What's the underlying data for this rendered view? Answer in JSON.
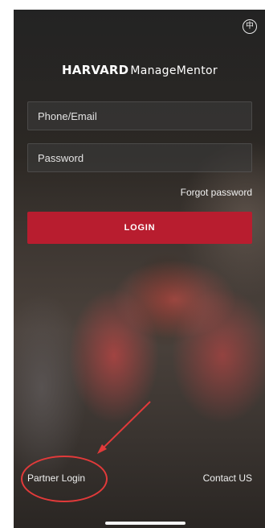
{
  "header": {
    "language_icon": "globe-icon",
    "language_glyph": "中",
    "logo_brand": "HARVARD",
    "logo_product": "ManageMentor"
  },
  "form": {
    "phone_email_placeholder": "Phone/Email",
    "password_placeholder": "Password",
    "forgot_password_label": "Forgot password",
    "login_label": "LOGIN"
  },
  "footer": {
    "partner_login_label": "Partner Login",
    "contact_label": "Contact US"
  },
  "colors": {
    "login_button": "#b81d2f",
    "annotation": "#e23a3a"
  }
}
